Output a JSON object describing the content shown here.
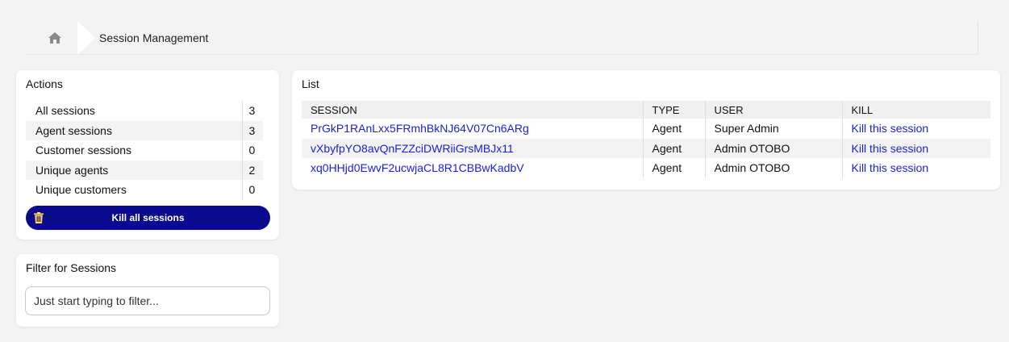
{
  "breadcrumb": {
    "current": "Session Management"
  },
  "actions": {
    "title": "Actions",
    "stats": [
      {
        "label": "All sessions",
        "value": "3"
      },
      {
        "label": "Agent sessions",
        "value": "3"
      },
      {
        "label": "Customer sessions",
        "value": "0"
      },
      {
        "label": "Unique agents",
        "value": "2"
      },
      {
        "label": "Unique customers",
        "value": "0"
      }
    ],
    "kill_all_label": "Kill all sessions"
  },
  "filter": {
    "title": "Filter for Sessions",
    "placeholder": "Just start typing to filter..."
  },
  "list": {
    "title": "List",
    "headers": {
      "session": "SESSION",
      "type": "TYPE",
      "user": "USER",
      "kill": "KILL"
    },
    "rows": [
      {
        "session": "PrGkP1RAnLxx5FRmhBkNJ64V07Cn6ARg",
        "type": "Agent",
        "user": "Super Admin",
        "kill": "Kill this session"
      },
      {
        "session": "vXbyfpYO8avQnFZZciDWRiiGrsMBJx11",
        "type": "Agent",
        "user": "Admin OTOBO",
        "kill": "Kill this session"
      },
      {
        "session": "xq0HHjd0EwvF2ucwjaCL8R1CBBwKadbV",
        "type": "Agent",
        "user": "Admin OTOBO",
        "kill": "Kill this session"
      }
    ]
  },
  "colors": {
    "accent": "#0a0a8e",
    "link": "#1b22d6",
    "background": "#f3f3f3"
  },
  "icons": {
    "home": "home-icon",
    "kill_all": "trash-icon"
  }
}
